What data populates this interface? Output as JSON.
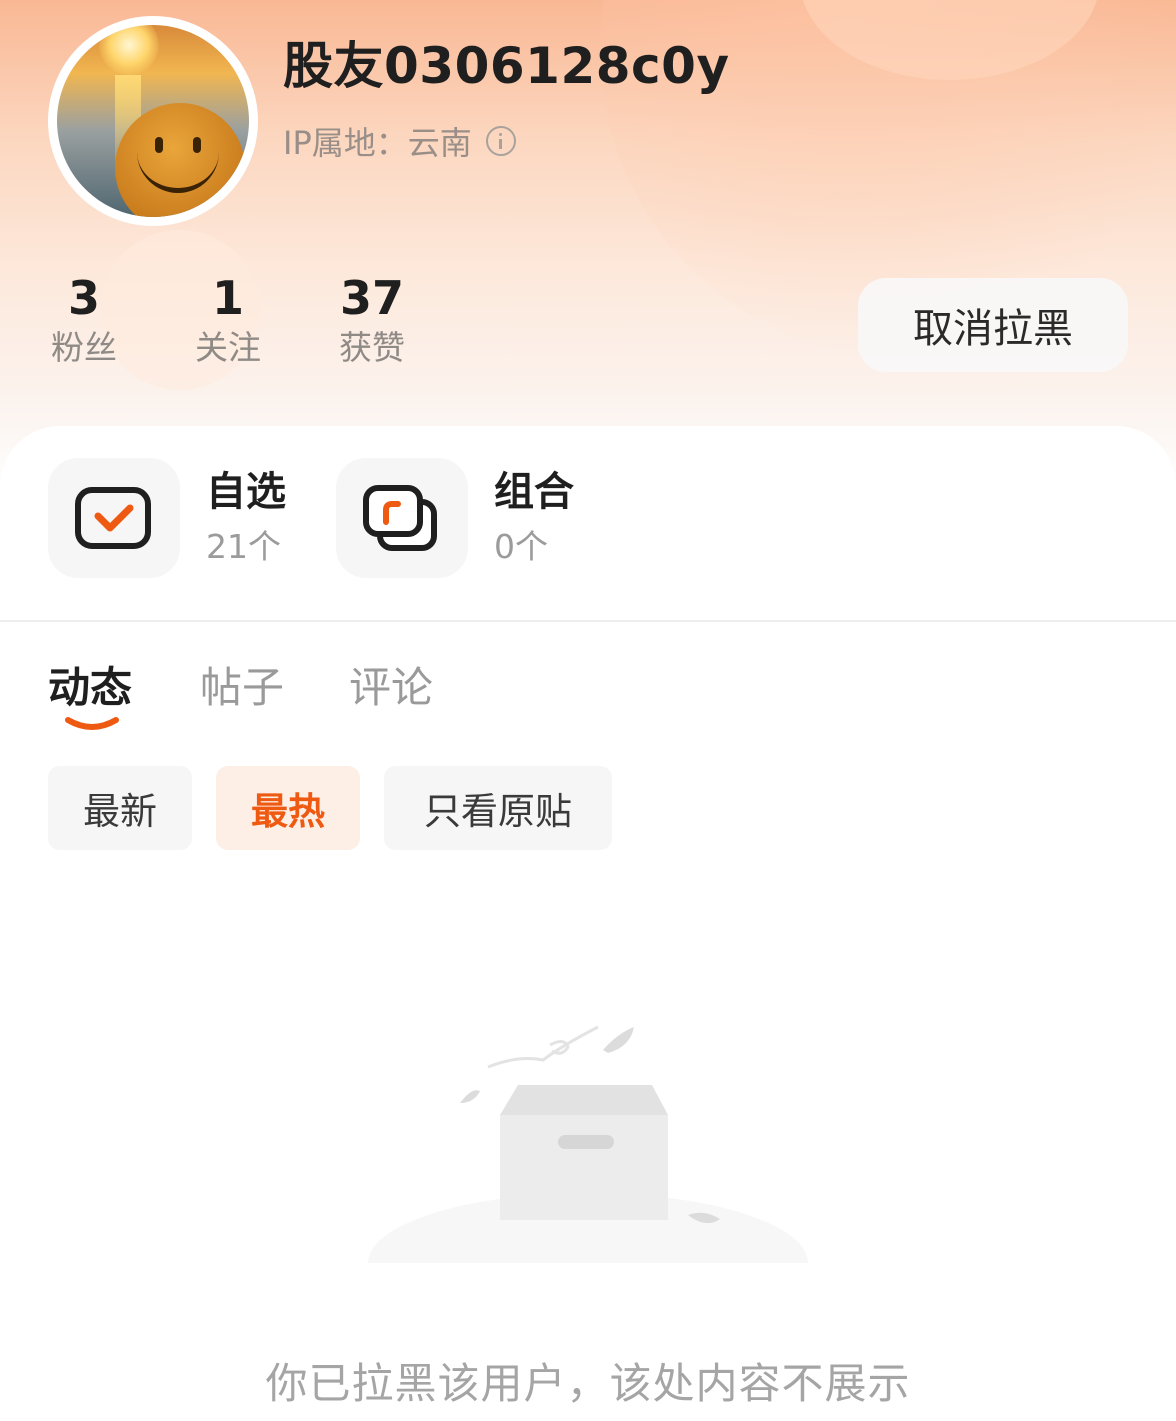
{
  "profile": {
    "username": "股友0306128c0y",
    "ip_location": "IP属地：云南"
  },
  "stats": [
    {
      "value": "3",
      "label": "粉丝"
    },
    {
      "value": "1",
      "label": "关注"
    },
    {
      "value": "37",
      "label": "获赞"
    }
  ],
  "actions": {
    "unblock_label": "取消拉黑"
  },
  "features": [
    {
      "title": "自选",
      "count": "21个",
      "icon": "watchlist-check-icon"
    },
    {
      "title": "组合",
      "count": "0个",
      "icon": "portfolio-squares-icon"
    }
  ],
  "tabs": [
    {
      "label": "动态",
      "active": true
    },
    {
      "label": "帖子",
      "active": false
    },
    {
      "label": "评论",
      "active": false
    }
  ],
  "filters": [
    {
      "label": "最新",
      "selected": false
    },
    {
      "label": "最热",
      "selected": true
    },
    {
      "label": "只看原贴",
      "selected": false
    }
  ],
  "empty_state": {
    "message": "你已拉黑该用户，该处内容不展示",
    "icon": "empty-box-icon"
  },
  "colors": {
    "accent": "#ef5a12",
    "header_gradient_top": "#f9b894",
    "chip_selected_bg": "#fdeee6"
  }
}
